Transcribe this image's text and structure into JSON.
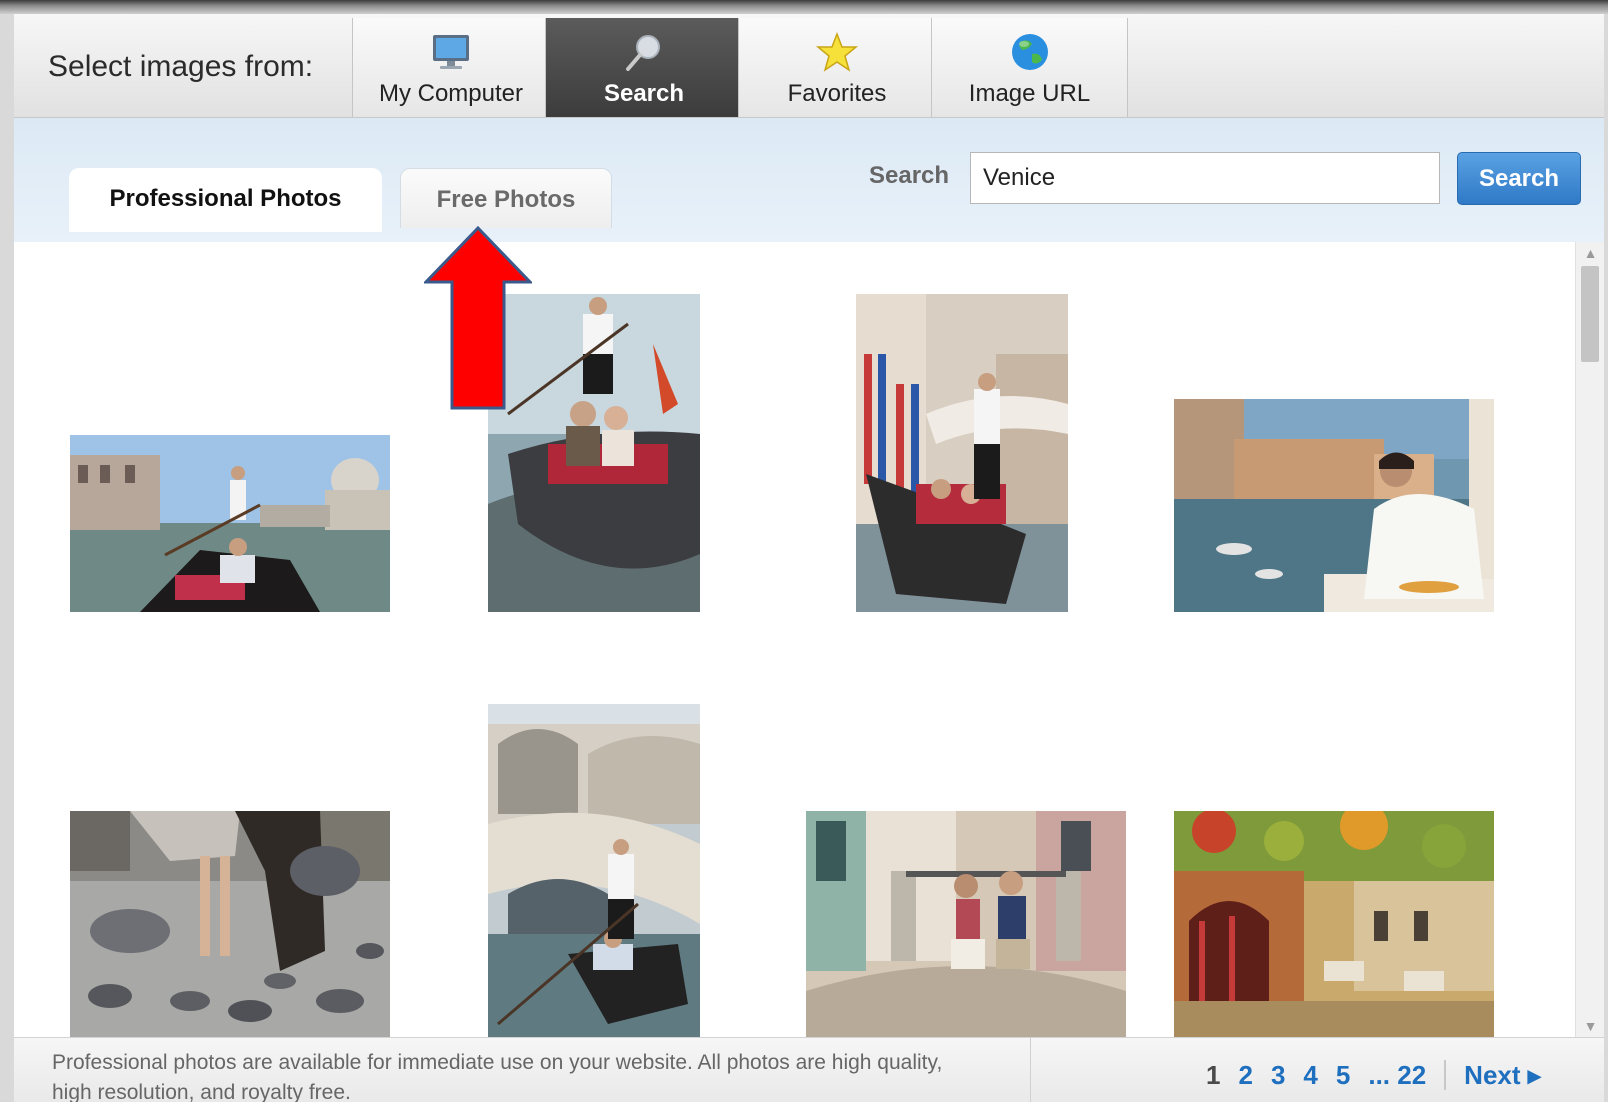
{
  "source_bar": {
    "label": "Select images from:",
    "tabs": [
      {
        "label": "My Computer",
        "icon": "monitor-icon",
        "active": false
      },
      {
        "label": "Search",
        "icon": "magnifier-icon",
        "active": true
      },
      {
        "label": "Favorites",
        "icon": "star-icon",
        "active": false
      },
      {
        "label": "Image URL",
        "icon": "globe-icon",
        "active": false
      }
    ]
  },
  "photo_tabs": [
    {
      "label": "Professional Photos",
      "active": true
    },
    {
      "label": "Free Photos",
      "active": false
    }
  ],
  "search": {
    "label": "Search",
    "value": "Venice",
    "button": "Search"
  },
  "results": {
    "images": [
      {
        "name": "gondola-canal-salute"
      },
      {
        "name": "couple-in-gondola"
      },
      {
        "name": "gondolier-narrow-canal"
      },
      {
        "name": "woman-balcony-breakfast"
      },
      {
        "name": "pigeons-square"
      },
      {
        "name": "rialto-bridge-gondola"
      },
      {
        "name": "couple-on-bridge"
      },
      {
        "name": "restaurant-courtyard"
      }
    ]
  },
  "footer": {
    "note": "Professional photos are available for immediate use on your website. All photos are high quality, high resolution, and royalty free.",
    "pages": [
      "1",
      "2",
      "3",
      "4",
      "5",
      "... 22"
    ],
    "current_page": "1",
    "next": "Next ▸"
  },
  "colors": {
    "active_tab": "#4a4a4a",
    "link_blue": "#1f6fbf",
    "search_button": "#3a85d2",
    "annotation_arrow": "#ff0000"
  }
}
